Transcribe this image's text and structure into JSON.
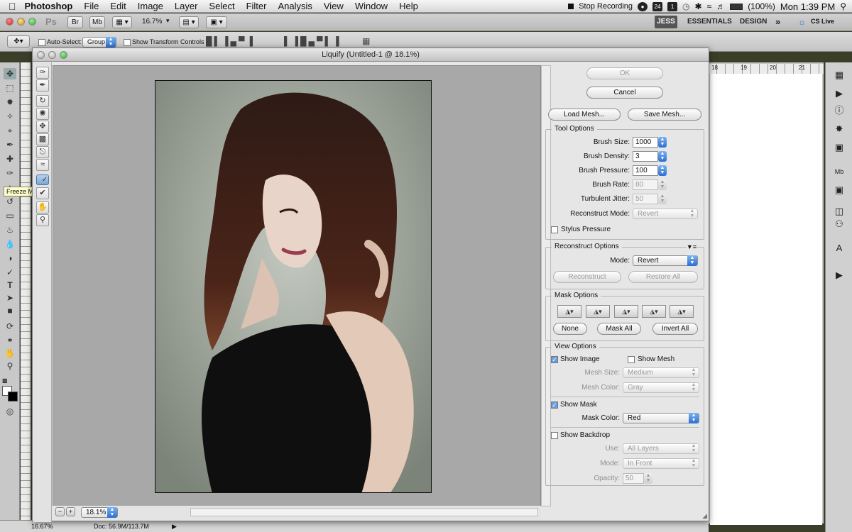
{
  "menubar": {
    "apple": "",
    "app_name": "Photoshop",
    "items": [
      "File",
      "Edit",
      "Image",
      "Layer",
      "Select",
      "Filter",
      "Analysis",
      "View",
      "Window",
      "Help"
    ],
    "stop_recording": "Stop Recording",
    "battery": "(100%)",
    "clock": "Mon 1:39 PM",
    "badge_24": "24",
    "badge_1": "1"
  },
  "appbar": {
    "ps_logo": "Ps",
    "br": "Br",
    "mb": "Mb",
    "zoom": "16.7%",
    "workspace_user": "JESS",
    "workspace_essentials": "ESSENTIALS",
    "workspace_design": "DESIGN",
    "more": "»",
    "cs_live": "CS Live"
  },
  "optbar": {
    "auto_select_label": "Auto-Select:",
    "auto_select_value": "Group",
    "show_transform": "Show Transform Controls"
  },
  "liquify": {
    "title": "Liquify (Untitled-1 @ 18.1%)",
    "zoom_value": "18.1%",
    "tooltip": "Freeze Mask Tool (F)",
    "ok": "OK",
    "cancel": "Cancel",
    "load_mesh": "Load Mesh...",
    "save_mesh": "Save Mesh...",
    "tool_options": {
      "title": "Tool Options",
      "brush_size_label": "Brush Size:",
      "brush_size": "1000",
      "brush_density_label": "Brush Density:",
      "brush_density": "3",
      "brush_pressure_label": "Brush Pressure:",
      "brush_pressure": "100",
      "brush_rate_label": "Brush Rate:",
      "brush_rate": "80",
      "turbulent_jitter_label": "Turbulent Jitter:",
      "turbulent_jitter": "50",
      "reconstruct_mode_label": "Reconstruct Mode:",
      "reconstruct_mode": "Revert",
      "stylus_pressure": "Stylus Pressure"
    },
    "reconstruct_options": {
      "title": "Reconstruct Options",
      "mode_label": "Mode:",
      "mode": "Revert",
      "reconstruct": "Reconstruct",
      "restore_all": "Restore All"
    },
    "mask_options": {
      "title": "Mask Options",
      "none": "None",
      "mask_all": "Mask All",
      "invert_all": "Invert All"
    },
    "view_options": {
      "title": "View Options",
      "show_image": "Show Image",
      "show_mesh": "Show Mesh",
      "mesh_size_label": "Mesh Size:",
      "mesh_size": "Medium",
      "mesh_color_label": "Mesh Color:",
      "mesh_color": "Gray",
      "show_mask": "Show Mask",
      "mask_color_label": "Mask Color:",
      "mask_color": "Red",
      "show_backdrop": "Show Backdrop",
      "use_label": "Use:",
      "use": "All Layers",
      "mode_label": "Mode:",
      "mode": "In Front",
      "opacity_label": "Opacity:",
      "opacity": "50"
    }
  },
  "statusbar": {
    "zoom": "16.67%",
    "doc": "Doc: 56.9M/113.7M"
  },
  "ruler": {
    "ticks": [
      "18",
      "19",
      "20",
      "21"
    ]
  },
  "colors": {
    "accent_blue": "#2d6fd1",
    "mask_red": "#cc0000"
  }
}
